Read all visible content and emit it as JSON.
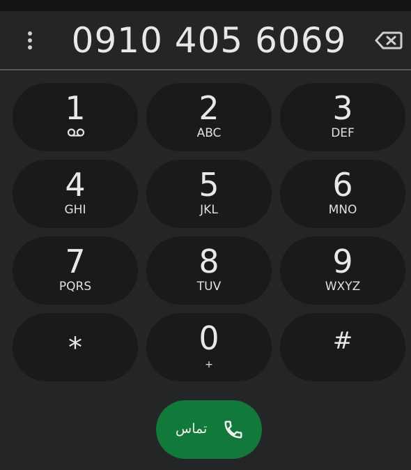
{
  "dialer": {
    "number": "0910 405 6069"
  },
  "keypad": [
    {
      "digit": "1",
      "letters": ""
    },
    {
      "digit": "2",
      "letters": "ABC"
    },
    {
      "digit": "3",
      "letters": "DEF"
    },
    {
      "digit": "4",
      "letters": "GHI"
    },
    {
      "digit": "5",
      "letters": "JKL"
    },
    {
      "digit": "6",
      "letters": "MNO"
    },
    {
      "digit": "7",
      "letters": "PQRS"
    },
    {
      "digit": "8",
      "letters": "TUV"
    },
    {
      "digit": "9",
      "letters": "WXYZ"
    },
    {
      "digit": "*",
      "letters": ""
    },
    {
      "digit": "0",
      "letters": "+"
    },
    {
      "digit": "#",
      "letters": ""
    }
  ],
  "call": {
    "label": "تماس"
  },
  "colors": {
    "background": "#242527",
    "key": "#1a1a1a",
    "call_button": "#117a3b",
    "text": "#e8e8e8"
  },
  "icons": {
    "menu": "more-vert-icon",
    "backspace": "backspace-icon",
    "voicemail": "voicemail-icon",
    "call": "phone-icon"
  }
}
